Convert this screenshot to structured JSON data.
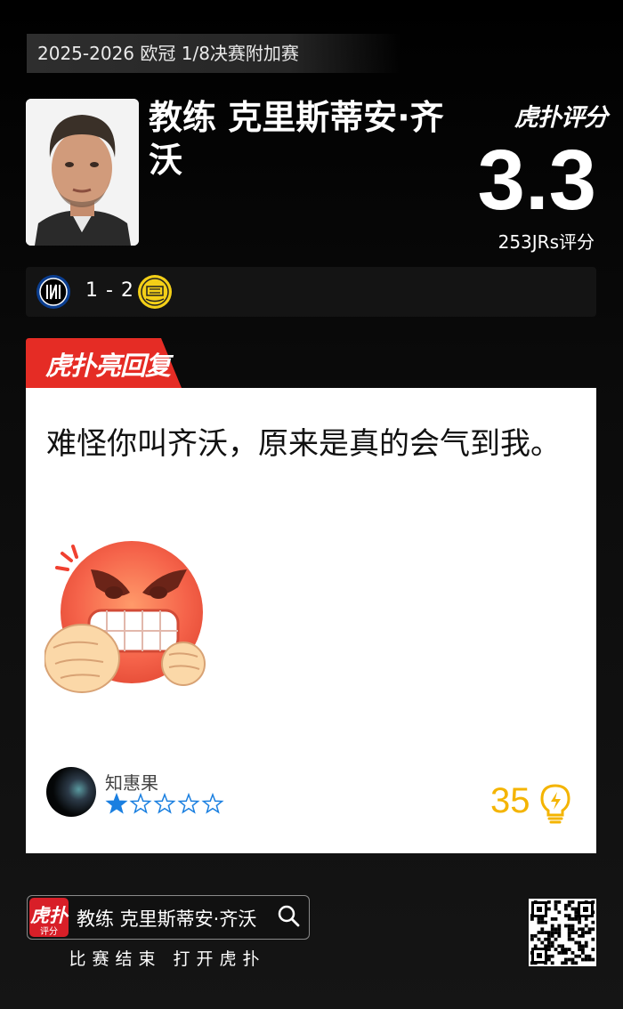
{
  "match_label": "2025-2026 欧冠 1/8决赛附加赛",
  "person": {
    "name": "教练 克里斯蒂安·齐沃"
  },
  "brand_logo_text": "虎扑评分",
  "rating": {
    "score": "3.3",
    "votes": "253JRs评分"
  },
  "result": {
    "scoreline": "1 - 2",
    "home_team_icon": "inter-milan-badge",
    "away_team_icon": "bodo-glimt-badge"
  },
  "highlight_tab": {
    "label": "虎扑亮回复",
    "color": "#e52c25"
  },
  "comment": {
    "text": "难怪你叫齐沃，原来是真的会气到我。",
    "sticker_icon": "angry-face-fists-emoji",
    "username": "知惠果",
    "stars_filled": 1,
    "stars_total": 5,
    "likes": "35",
    "like_icon": "lightbulb-icon"
  },
  "footer": {
    "app_icon_top": "虎扑",
    "app_icon_bottom": "评分",
    "search_text": "教练 克里斯蒂安·齐沃",
    "caption": "比赛结束 打开虎扑",
    "qr_icon": "qr-code"
  },
  "colors": {
    "accent_red": "#e52c25",
    "likes_yellow": "#f4b400",
    "star_blue": "#1a7fe0"
  }
}
